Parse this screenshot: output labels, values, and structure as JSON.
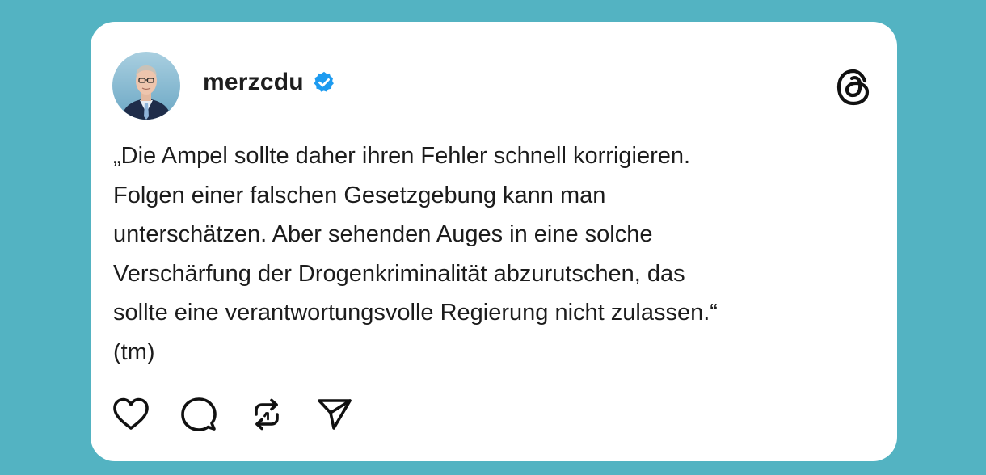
{
  "post": {
    "username": "merzcdu",
    "verified": true,
    "text": "„Die Ampel sollte daher ihren Fehler schnell korrigieren.\nFolgen einer falschen Gesetzgebung kann man\nunterschätzen. Aber sehenden Auges in eine solche\nVerschärfung der Drogenkriminalität abzurutschen, das\nsollte eine verantwortungsvolle Regierung nicht zulassen.“\n(tm)"
  },
  "icons": {
    "verified": "verified-badge-icon",
    "app_logo": "threads-logo-icon",
    "like": "heart-icon",
    "comment": "comment-bubble-icon",
    "repost": "repost-icon",
    "share": "send-icon"
  },
  "colors": {
    "background": "#53b3c2",
    "card": "#ffffff",
    "verified": "#1d9bf0",
    "text": "#1c1c1c"
  }
}
